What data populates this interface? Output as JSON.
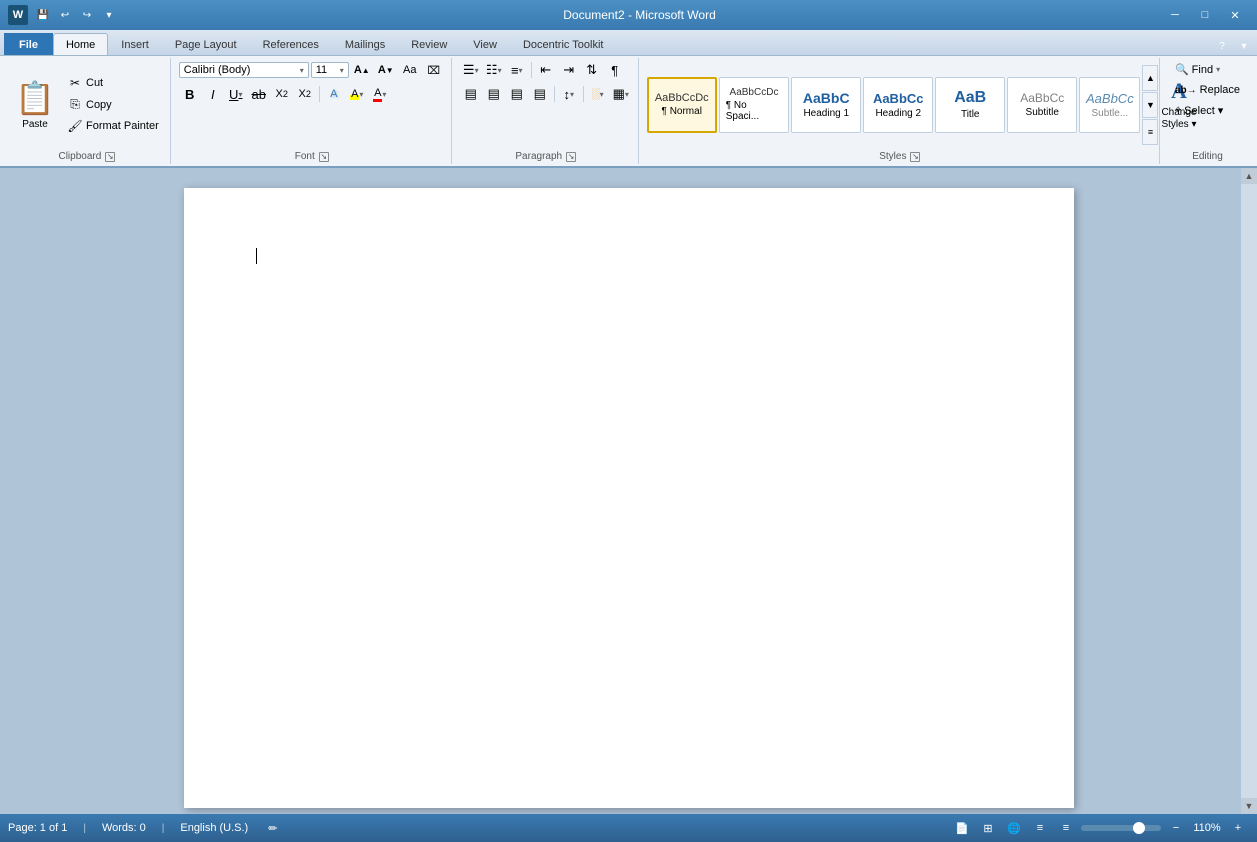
{
  "titlebar": {
    "title": "Document2 - Microsoft Word",
    "app_name": "W",
    "qs_buttons": [
      "undo",
      "redo",
      "customize"
    ],
    "window_buttons": [
      "minimize",
      "maximize",
      "close"
    ]
  },
  "tabs": [
    {
      "id": "file",
      "label": "File",
      "active": false,
      "is_file": true
    },
    {
      "id": "home",
      "label": "Home",
      "active": true
    },
    {
      "id": "insert",
      "label": "Insert",
      "active": false
    },
    {
      "id": "page_layout",
      "label": "Page Layout",
      "active": false
    },
    {
      "id": "references",
      "label": "References",
      "active": false
    },
    {
      "id": "mailings",
      "label": "Mailings",
      "active": false
    },
    {
      "id": "review",
      "label": "Review",
      "active": false
    },
    {
      "id": "view",
      "label": "View",
      "active": false
    },
    {
      "id": "docentric",
      "label": "Docentric Toolkit",
      "active": false
    }
  ],
  "ribbon": {
    "groups": [
      {
        "id": "clipboard",
        "label": "Clipboard",
        "paste_label": "Paste",
        "buttons": [
          {
            "id": "cut",
            "label": "Cut",
            "icon": "✂"
          },
          {
            "id": "copy",
            "label": "Copy",
            "icon": "📋"
          },
          {
            "id": "format_painter",
            "label": "Format Painter",
            "icon": "🖌"
          }
        ]
      },
      {
        "id": "font",
        "label": "Font",
        "font_name": "Calibri (Body)",
        "font_size": "11",
        "format_buttons": [
          "B",
          "I",
          "U",
          "abc",
          "x₂",
          "x²"
        ],
        "color_buttons": [
          "A",
          "A"
        ]
      },
      {
        "id": "paragraph",
        "label": "Paragraph"
      },
      {
        "id": "styles",
        "label": "Styles",
        "styles": [
          {
            "id": "normal",
            "label": "¶ Normal",
            "sample": "AaBbCcDc",
            "active": true
          },
          {
            "id": "no_spacing",
            "label": "¶ No Spaci...",
            "sample": "AaBbCcDc",
            "active": false
          },
          {
            "id": "heading1",
            "label": "Heading 1",
            "sample": "AaBbC",
            "active": false
          },
          {
            "id": "heading2",
            "label": "Heading 2",
            "sample": "AaBbCc",
            "active": false
          },
          {
            "id": "title",
            "label": "Title",
            "sample": "AaB",
            "active": false
          },
          {
            "id": "subtitle",
            "label": "Subtitle",
            "sample": "AaBbCc",
            "active": false
          }
        ],
        "change_styles_label": "Change\nStyles",
        "change_styles_icon": "A"
      },
      {
        "id": "editing",
        "label": "Editing",
        "buttons": [
          {
            "id": "find",
            "label": "Find",
            "icon": "🔍",
            "has_arrow": true
          },
          {
            "id": "replace",
            "label": "Replace",
            "icon": "ab"
          },
          {
            "id": "select",
            "label": "Select ▾",
            "icon": ""
          }
        ]
      }
    ]
  },
  "document": {
    "page_label": "Page: 1 of 1",
    "words_label": "Words: 0",
    "language": "English (U.S.)",
    "zoom": "110%",
    "zoom_value": 65
  },
  "icons": {
    "paste": "📋",
    "cut": "✂",
    "copy": "⎘",
    "format_painter": "🖌",
    "bold": "B",
    "italic": "I",
    "underline": "U",
    "strikethrough": "S",
    "subscript": "x₂",
    "superscript": "x²",
    "font_color": "A",
    "text_highlight": "A",
    "find": "🔍",
    "change_styles": "A",
    "grow_font": "A↑",
    "shrink_font": "A↓",
    "clear_format": "⌧",
    "bullets": "☰",
    "numbering": "☷",
    "multilevel": "≡",
    "decrease_indent": "⇤",
    "increase_indent": "⇥",
    "sort": "⇅",
    "show_para": "¶",
    "align_left": "≡",
    "align_center": "≡",
    "align_right": "≡",
    "justify": "≡",
    "line_spacing": "↕",
    "shading": "░",
    "borders": "▦"
  },
  "status": {
    "page": "Page: 1 of 1",
    "words": "Words: 0",
    "language": "English (U.S.)",
    "zoom": "110%",
    "track_icon": "✏",
    "layout_icon": "📄"
  }
}
